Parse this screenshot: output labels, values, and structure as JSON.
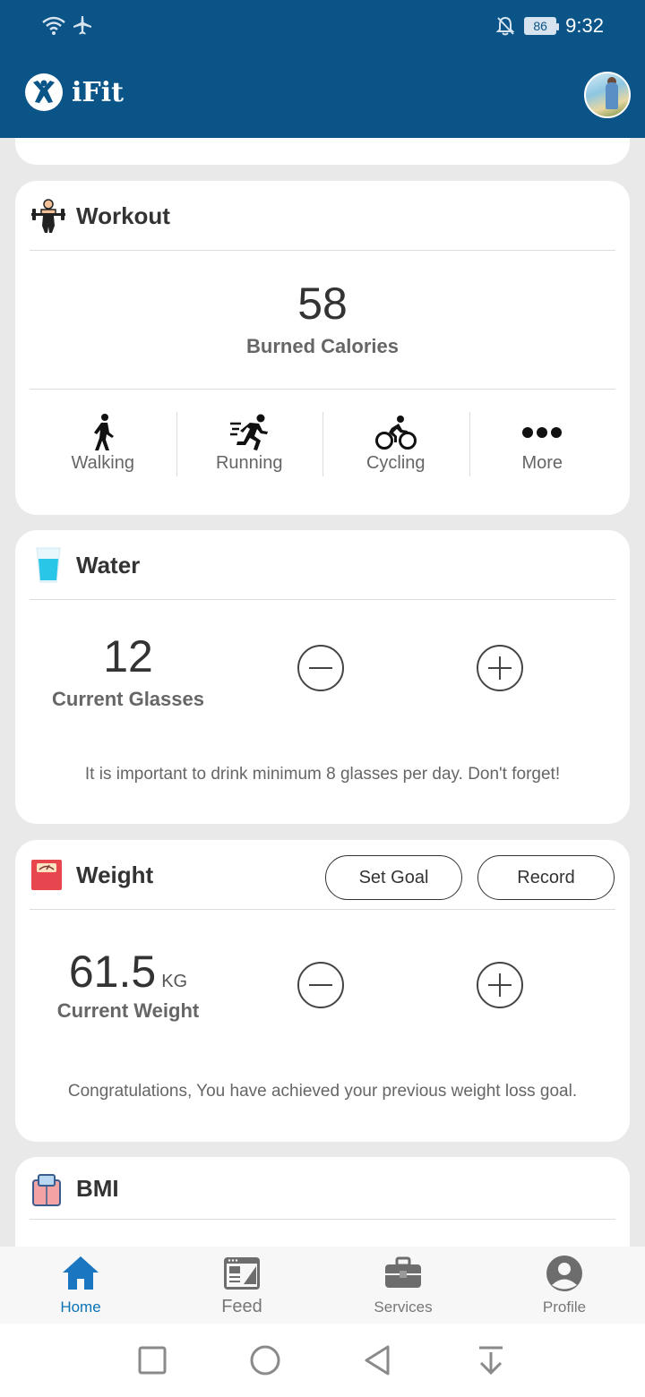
{
  "status_bar": {
    "battery": "86",
    "time": "9:32"
  },
  "app": {
    "name": "iFit"
  },
  "workout": {
    "title": "Workout",
    "calories_value": "58",
    "calories_label": "Burned Calories",
    "activities": [
      {
        "label": "Walking",
        "icon": "walking-icon"
      },
      {
        "label": "Running",
        "icon": "running-icon"
      },
      {
        "label": "Cycling",
        "icon": "cycling-icon"
      },
      {
        "label": "More",
        "icon": "more-icon"
      }
    ]
  },
  "water": {
    "title": "Water",
    "value": "12",
    "label": "Current Glasses",
    "note": "It is important to drink minimum 8 glasses per day. Don't forget!"
  },
  "weight": {
    "title": "Weight",
    "set_goal_label": "Set Goal",
    "record_label": "Record",
    "value": "61.5",
    "unit": "KG",
    "label": "Current Weight",
    "note": "Congratulations, You have achieved your previous weight loss goal."
  },
  "bmi": {
    "title": "BMI"
  },
  "bottom_nav": {
    "items": [
      {
        "label": "Home",
        "icon": "home-icon",
        "active": true
      },
      {
        "label": "Feed",
        "icon": "feed-icon",
        "active": false
      },
      {
        "label": "Services",
        "icon": "services-icon",
        "active": false
      },
      {
        "label": "Profile",
        "icon": "profile-icon",
        "active": false
      }
    ]
  },
  "colors": {
    "primary": "#0a5488",
    "accent": "#0a73b6",
    "background": "#e9e9e9"
  }
}
